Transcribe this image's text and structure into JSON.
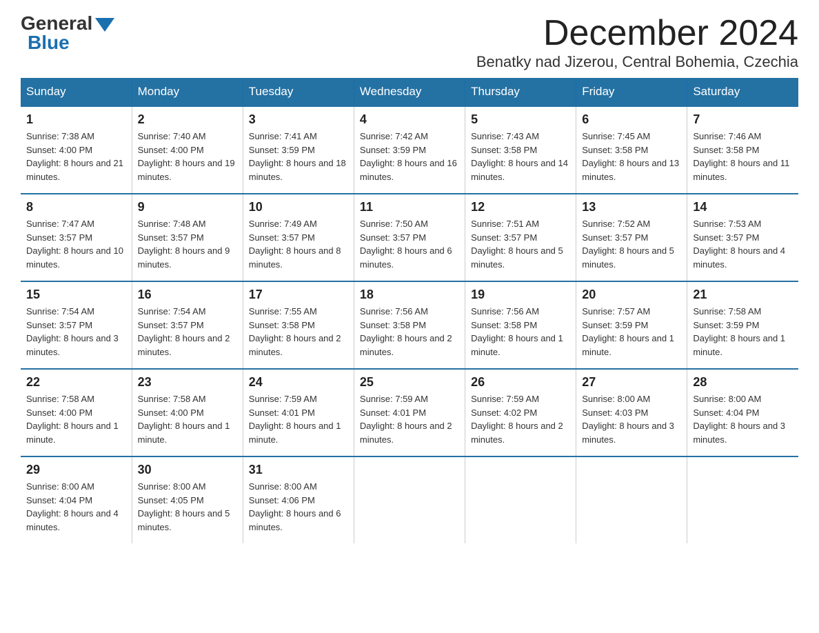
{
  "logo": {
    "general": "General",
    "blue": "Blue"
  },
  "title": "December 2024",
  "subtitle": "Benatky nad Jizerou, Central Bohemia, Czechia",
  "weekdays": [
    "Sunday",
    "Monday",
    "Tuesday",
    "Wednesday",
    "Thursday",
    "Friday",
    "Saturday"
  ],
  "weeks": [
    [
      {
        "day": "1",
        "sunrise": "7:38 AM",
        "sunset": "4:00 PM",
        "daylight": "8 hours and 21 minutes."
      },
      {
        "day": "2",
        "sunrise": "7:40 AM",
        "sunset": "4:00 PM",
        "daylight": "8 hours and 19 minutes."
      },
      {
        "day": "3",
        "sunrise": "7:41 AM",
        "sunset": "3:59 PM",
        "daylight": "8 hours and 18 minutes."
      },
      {
        "day": "4",
        "sunrise": "7:42 AM",
        "sunset": "3:59 PM",
        "daylight": "8 hours and 16 minutes."
      },
      {
        "day": "5",
        "sunrise": "7:43 AM",
        "sunset": "3:58 PM",
        "daylight": "8 hours and 14 minutes."
      },
      {
        "day": "6",
        "sunrise": "7:45 AM",
        "sunset": "3:58 PM",
        "daylight": "8 hours and 13 minutes."
      },
      {
        "day": "7",
        "sunrise": "7:46 AM",
        "sunset": "3:58 PM",
        "daylight": "8 hours and 11 minutes."
      }
    ],
    [
      {
        "day": "8",
        "sunrise": "7:47 AM",
        "sunset": "3:57 PM",
        "daylight": "8 hours and 10 minutes."
      },
      {
        "day": "9",
        "sunrise": "7:48 AM",
        "sunset": "3:57 PM",
        "daylight": "8 hours and 9 minutes."
      },
      {
        "day": "10",
        "sunrise": "7:49 AM",
        "sunset": "3:57 PM",
        "daylight": "8 hours and 8 minutes."
      },
      {
        "day": "11",
        "sunrise": "7:50 AM",
        "sunset": "3:57 PM",
        "daylight": "8 hours and 6 minutes."
      },
      {
        "day": "12",
        "sunrise": "7:51 AM",
        "sunset": "3:57 PM",
        "daylight": "8 hours and 5 minutes."
      },
      {
        "day": "13",
        "sunrise": "7:52 AM",
        "sunset": "3:57 PM",
        "daylight": "8 hours and 5 minutes."
      },
      {
        "day": "14",
        "sunrise": "7:53 AM",
        "sunset": "3:57 PM",
        "daylight": "8 hours and 4 minutes."
      }
    ],
    [
      {
        "day": "15",
        "sunrise": "7:54 AM",
        "sunset": "3:57 PM",
        "daylight": "8 hours and 3 minutes."
      },
      {
        "day": "16",
        "sunrise": "7:54 AM",
        "sunset": "3:57 PM",
        "daylight": "8 hours and 2 minutes."
      },
      {
        "day": "17",
        "sunrise": "7:55 AM",
        "sunset": "3:58 PM",
        "daylight": "8 hours and 2 minutes."
      },
      {
        "day": "18",
        "sunrise": "7:56 AM",
        "sunset": "3:58 PM",
        "daylight": "8 hours and 2 minutes."
      },
      {
        "day": "19",
        "sunrise": "7:56 AM",
        "sunset": "3:58 PM",
        "daylight": "8 hours and 1 minute."
      },
      {
        "day": "20",
        "sunrise": "7:57 AM",
        "sunset": "3:59 PM",
        "daylight": "8 hours and 1 minute."
      },
      {
        "day": "21",
        "sunrise": "7:58 AM",
        "sunset": "3:59 PM",
        "daylight": "8 hours and 1 minute."
      }
    ],
    [
      {
        "day": "22",
        "sunrise": "7:58 AM",
        "sunset": "4:00 PM",
        "daylight": "8 hours and 1 minute."
      },
      {
        "day": "23",
        "sunrise": "7:58 AM",
        "sunset": "4:00 PM",
        "daylight": "8 hours and 1 minute."
      },
      {
        "day": "24",
        "sunrise": "7:59 AM",
        "sunset": "4:01 PM",
        "daylight": "8 hours and 1 minute."
      },
      {
        "day": "25",
        "sunrise": "7:59 AM",
        "sunset": "4:01 PM",
        "daylight": "8 hours and 2 minutes."
      },
      {
        "day": "26",
        "sunrise": "7:59 AM",
        "sunset": "4:02 PM",
        "daylight": "8 hours and 2 minutes."
      },
      {
        "day": "27",
        "sunrise": "8:00 AM",
        "sunset": "4:03 PM",
        "daylight": "8 hours and 3 minutes."
      },
      {
        "day": "28",
        "sunrise": "8:00 AM",
        "sunset": "4:04 PM",
        "daylight": "8 hours and 3 minutes."
      }
    ],
    [
      {
        "day": "29",
        "sunrise": "8:00 AM",
        "sunset": "4:04 PM",
        "daylight": "8 hours and 4 minutes."
      },
      {
        "day": "30",
        "sunrise": "8:00 AM",
        "sunset": "4:05 PM",
        "daylight": "8 hours and 5 minutes."
      },
      {
        "day": "31",
        "sunrise": "8:00 AM",
        "sunset": "4:06 PM",
        "daylight": "8 hours and 6 minutes."
      },
      null,
      null,
      null,
      null
    ]
  ]
}
